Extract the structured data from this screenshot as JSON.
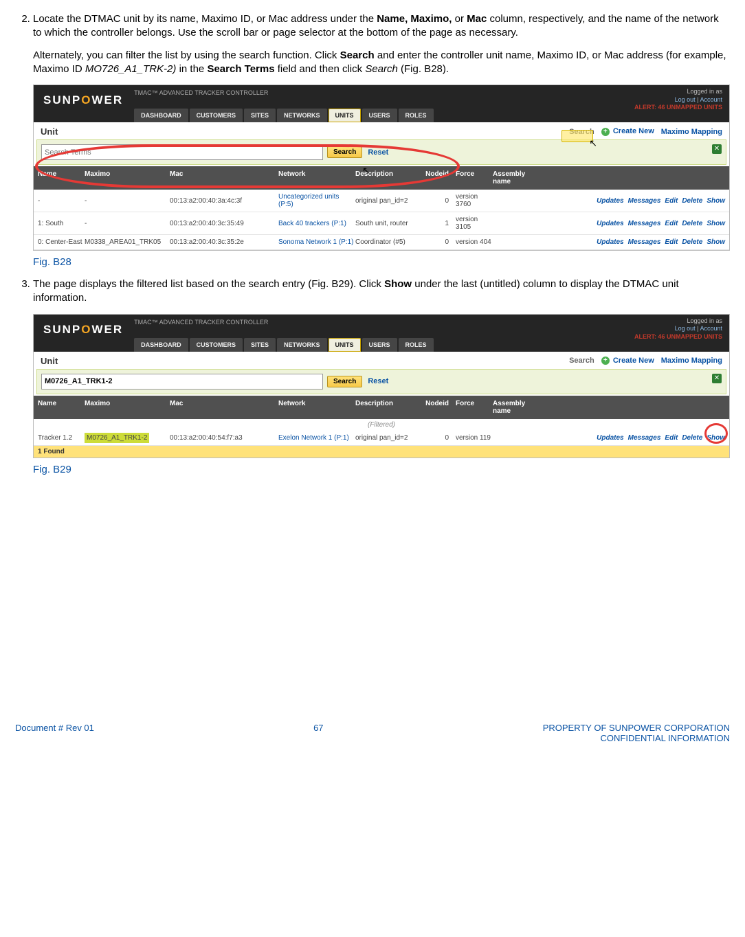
{
  "steps": {
    "n2": "2.",
    "p2a": "Locate the DTMAC unit by its name, Maximo ID, or Mac address under the ",
    "p2a_b1": "Name, Maximo,",
    "p2a_mid": " or ",
    "p2a_b2": "Mac",
    "p2a_end": " column, respectively, and the name of the network to which the controller belongs. Use the scroll bar or page selector at the bottom of the page as necessary.",
    "p2b_a": "Alternately, you can filter the list by using the search function. Click ",
    "p2b_b1": "Search",
    "p2b_mid1": " and enter the controller unit name, Maximo ID, or Mac address (for example, Maximo ID ",
    "p2b_i1": "MO726_A1_TRK-2)",
    "p2b_mid2": " in the ",
    "p2b_b2": "Search Terms",
    "p2b_mid3": " field and then click ",
    "p2b_i2": "Search",
    "p2b_end": " (Fig. B28).",
    "n3": "3.",
    "p3a": "The page displays the filtered list based on the search entry (Fig. B29). Click ",
    "p3b1": "Show",
    "p3end": " under the last (untitled) column to display the DTMAC unit information."
  },
  "captions": {
    "fig28": "Fig. B28",
    "fig29": "Fig. B29"
  },
  "app": {
    "logo_pre": "SUNP",
    "logo_o": "O",
    "logo_post": "WER",
    "title": "TMAC™ ADVANCED TRACKER CONTROLLER",
    "tabs": {
      "dashboard": "DASHBOARD",
      "customers": "CUSTOMERS",
      "sites": "SITES",
      "networks": "NETWORKS",
      "units": "UNITS",
      "users": "USERS",
      "roles": "ROLES"
    },
    "login": {
      "logged": "Logged in as",
      "logout": "Log out",
      "account": "Account",
      "alert": "ALERT: 46 UNMAPPED UNITS"
    },
    "unitbar": {
      "title": "Unit",
      "search": "Search",
      "create": "Create New",
      "mapping": "Maximo Mapping"
    },
    "searchbox": {
      "placeholder": "Search Terms",
      "value2": "M0726_A1_TRK1-2",
      "btn": "Search",
      "reset": "Reset"
    },
    "headers": {
      "name": "Name",
      "maximo": "Maximo",
      "mac": "Mac",
      "network": "Network",
      "desc": "Description",
      "nodeid": "Nodeid",
      "force": "Force",
      "asm": "Assembly name"
    },
    "actions": {
      "updates": "Updates",
      "messages": "Messages",
      "edit": "Edit",
      "delete": "Delete",
      "show": "Show"
    },
    "rows1": [
      {
        "name": "-",
        "maximo": "-",
        "mac": "00:13:a2:00:40:3a:4c:3f",
        "network": "Uncategorized units (P:5)",
        "desc": "original pan_id=2",
        "nodeid": "0",
        "force": "version 3760",
        "asm": ""
      },
      {
        "name": "1: South",
        "maximo": "-",
        "mac": "00:13:a2:00:40:3c:35:49",
        "network": "Back 40 trackers (P:1)",
        "desc": "South unit, router",
        "nodeid": "1",
        "force": "version 3105",
        "asm": ""
      },
      {
        "name": "0: Center-East",
        "maximo": "M0338_AREA01_TRK05",
        "mac": "00:13:a2:00:40:3c:35:2e",
        "network": "Sonoma Network 1 (P:1)",
        "desc": "Coordinator (#5)",
        "nodeid": "0",
        "force": "version 404",
        "asm": ""
      }
    ],
    "filtered_label": "(Filtered)",
    "rows2": [
      {
        "name": "Tracker 1.2",
        "maximo": "M0726_A1_TRK1-2",
        "mac": "00:13:a2:00:40:54:f7:a3",
        "network": "Exelon Network 1 (P:1)",
        "desc": "original pan_id=2",
        "nodeid": "0",
        "force": "version 119",
        "asm": ""
      }
    ],
    "found": "1 Found"
  },
  "footer": {
    "left": "Document #  Rev 01",
    "mid": "67",
    "right1": "PROPERTY OF SUNPOWER CORPORATION",
    "right2": "CONFIDENTIAL INFORMATION"
  }
}
